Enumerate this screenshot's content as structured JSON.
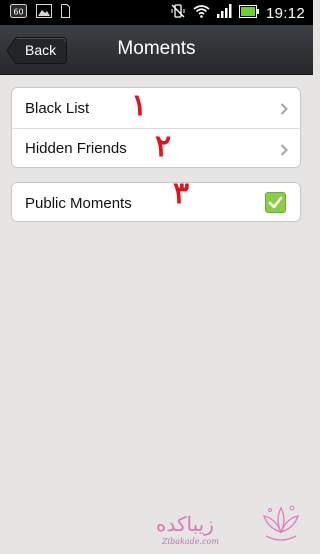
{
  "status_bar": {
    "clock": "19:12",
    "notification_badge": "60",
    "icons": [
      "gallery-icon",
      "sd-card-icon",
      "silent-vibrate-icon",
      "wifi-icon",
      "signal-icon",
      "battery-icon"
    ]
  },
  "header": {
    "back_label": "Back",
    "title": "Moments"
  },
  "settings": {
    "items": [
      {
        "label": "Black List",
        "annotation": "١"
      },
      {
        "label": "Hidden Friends",
        "annotation": "٢"
      }
    ],
    "public_moments": {
      "label": "Public Moments",
      "annotation": "٣",
      "checked": true
    }
  },
  "watermark": {
    "text": "زیباکده",
    "subtext": "Zibakade.com"
  },
  "colors": {
    "background": "#e6e5e4",
    "header": "#2f3236",
    "checkbox": "#8ccc47",
    "annotation": "#e0141c"
  }
}
